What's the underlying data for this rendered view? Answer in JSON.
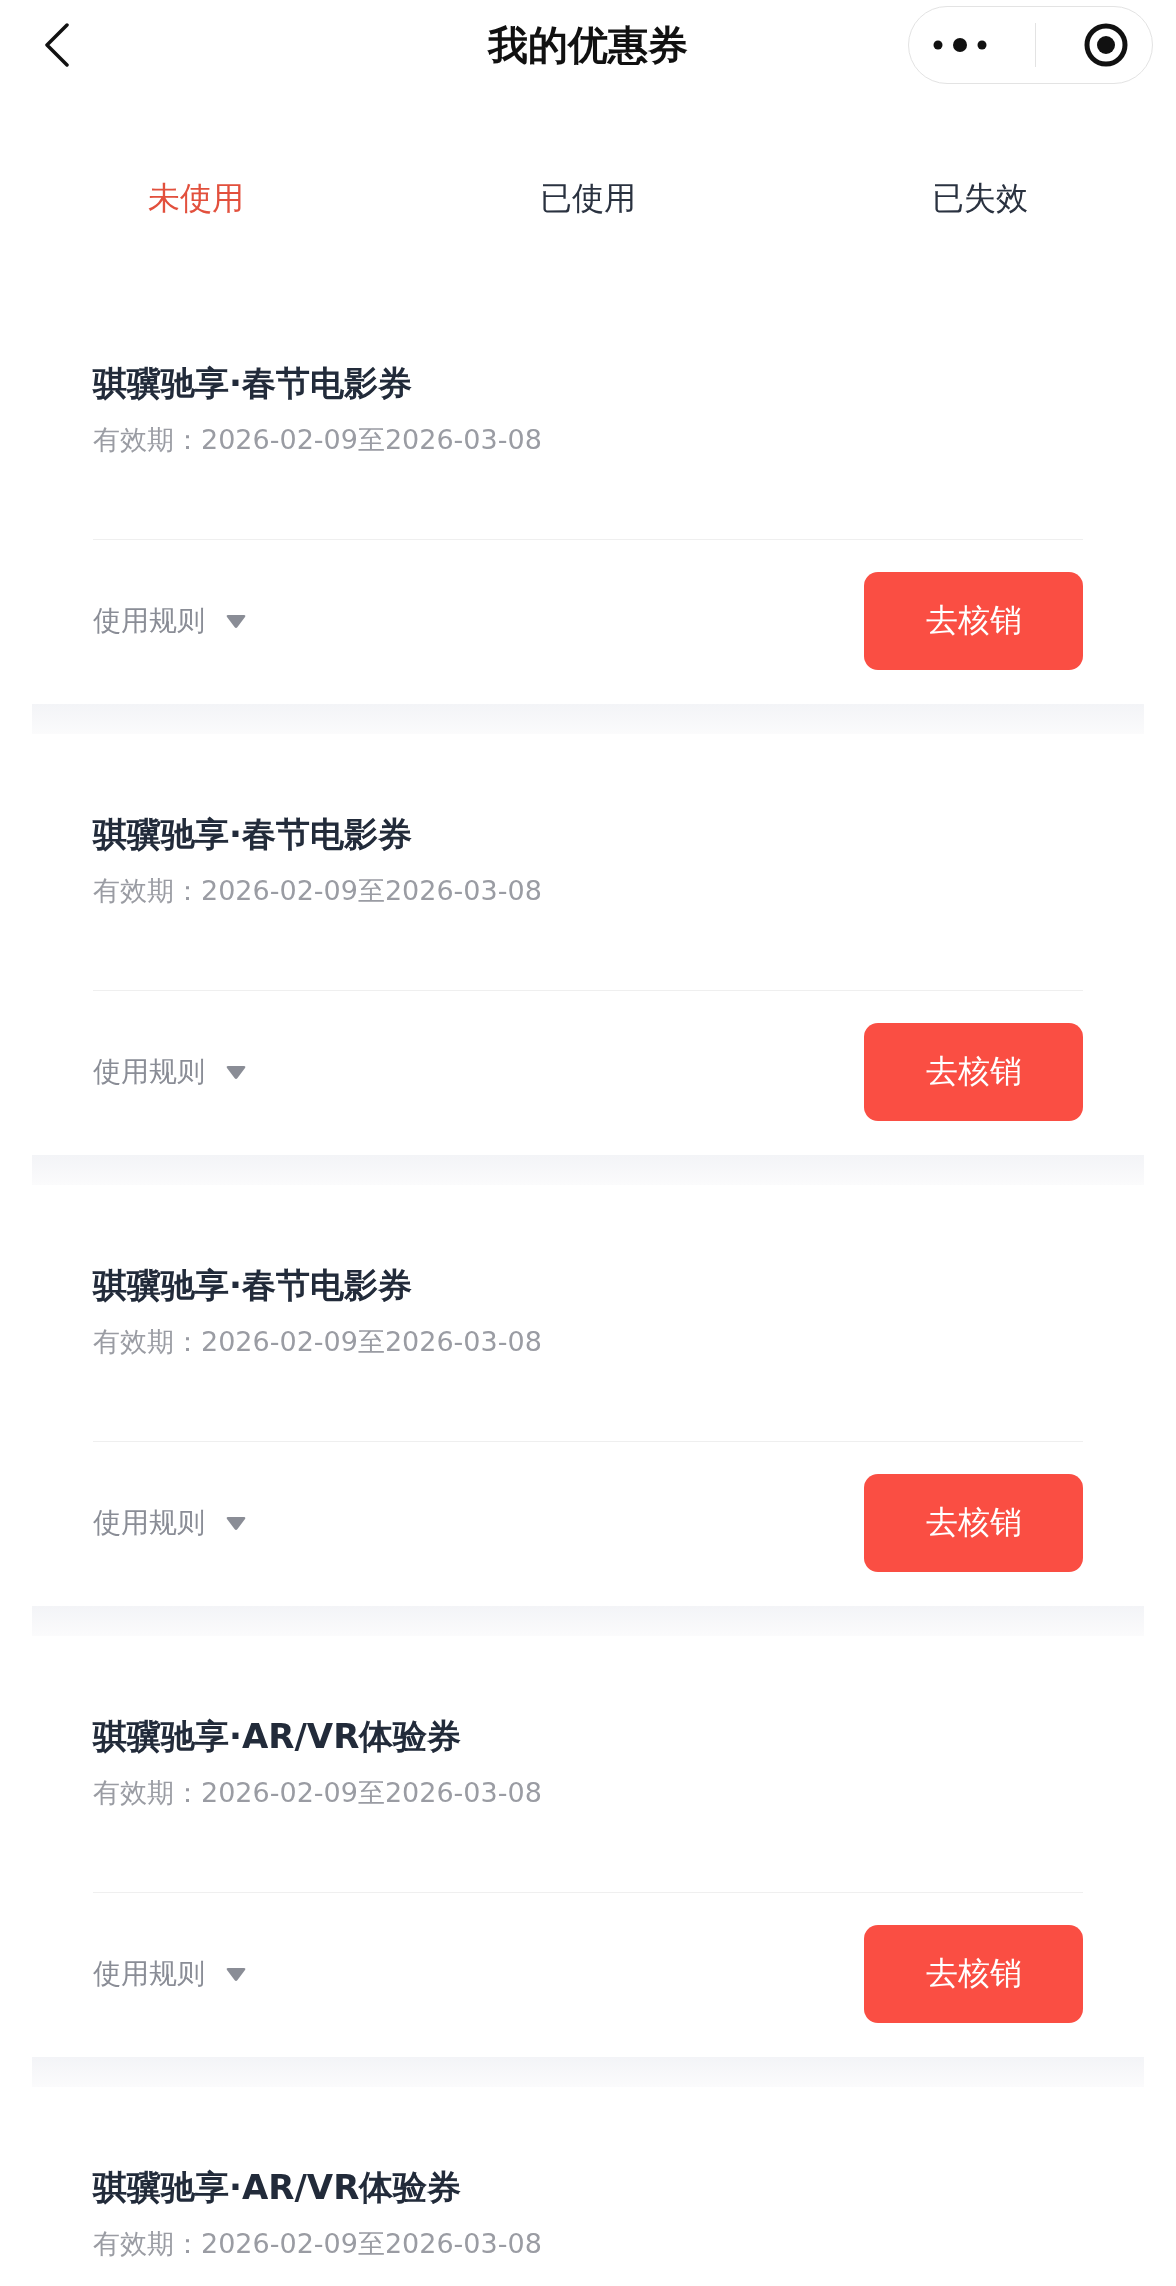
{
  "header": {
    "title": "我的优惠券"
  },
  "tabs": [
    {
      "label": "未使用",
      "selected": true
    },
    {
      "label": "已使用",
      "selected": false
    },
    {
      "label": "已失效",
      "selected": false
    }
  ],
  "coupons": [
    {
      "title": "骐骥驰享·春节电影券",
      "validity": "有效期：2026-02-09至2026-03-08",
      "rules": "使用规则",
      "button": "去核销"
    },
    {
      "title": "骐骥驰享·春节电影券",
      "validity": "有效期：2026-02-09至2026-03-08",
      "rules": "使用规则",
      "button": "去核销"
    },
    {
      "title": "骐骥驰享·春节电影券",
      "validity": "有效期：2026-02-09至2026-03-08",
      "rules": "使用规则",
      "button": "去核销"
    },
    {
      "title": "骐骥驰享·AR/VR体验券",
      "validity": "有效期：2026-02-09至2026-03-08",
      "rules": "使用规则",
      "button": "去核销"
    },
    {
      "title": "骐骥驰享·AR/VR体验券",
      "validity": "有效期：2026-02-09至2026-03-08"
    }
  ]
}
